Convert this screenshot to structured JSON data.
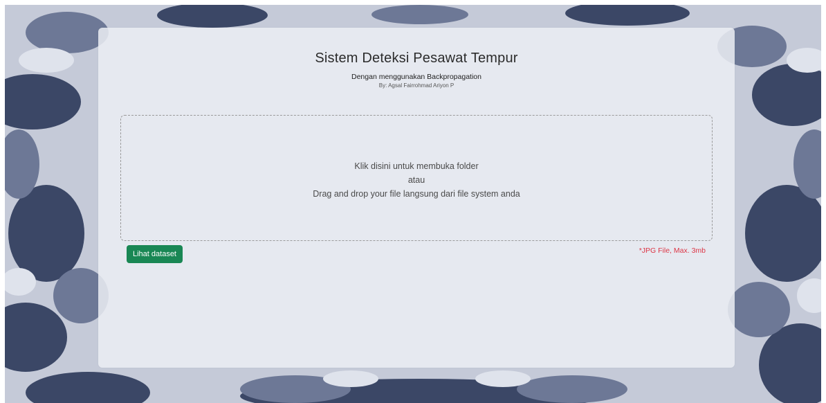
{
  "header": {
    "title": "Sistem Deteksi Pesawat Tempur",
    "subtitle": "Dengan menggunakan Backpropagation",
    "byline": "By: Agsal Fairrohmad Ariyon P"
  },
  "dropzone": {
    "line1": "Klik disini untuk membuka folder",
    "line2": "atau",
    "line3": "Drag and drop your file langsung dari file system anda"
  },
  "actions": {
    "dataset_button_label": "Lihat dataset",
    "file_note": "*JPG File, Max. 3mb"
  },
  "colors": {
    "button_bg": "#198754",
    "note_text": "#dc3545"
  }
}
